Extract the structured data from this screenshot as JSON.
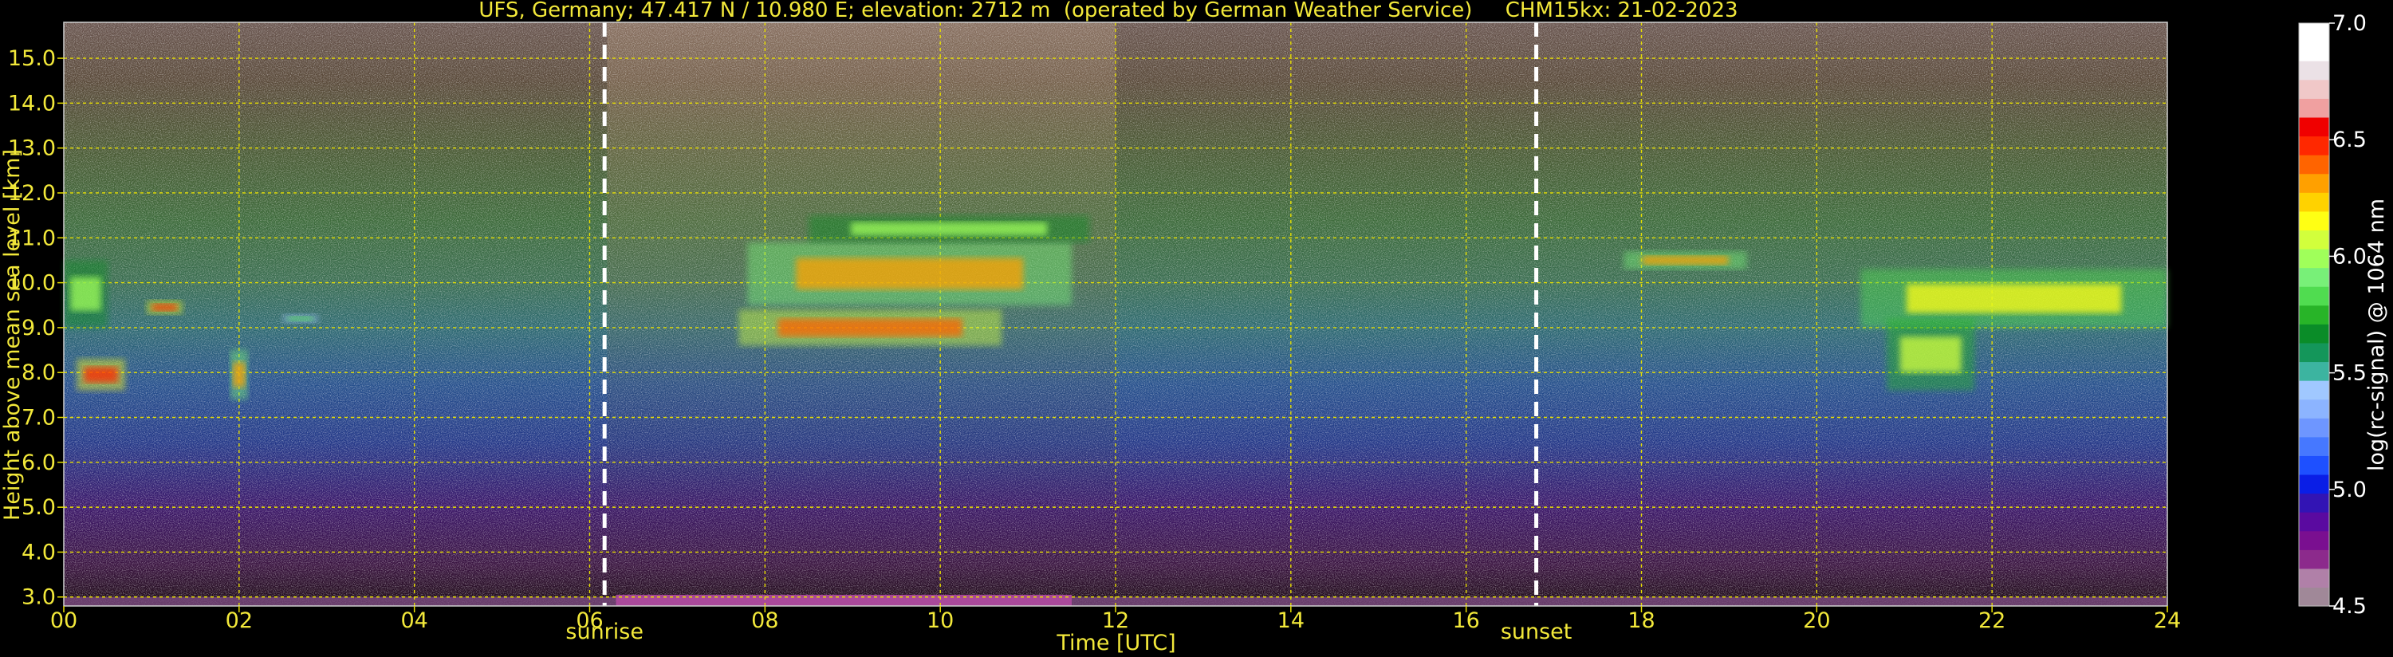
{
  "chart_data": {
    "type": "heatmap",
    "title": "UFS, Germany; 47.417 N / 10.980 E; elevation: 2712 m  (operated by German Weather Service)     CHM15kx: 21-02-2023",
    "xlabel": "Time [UTC]",
    "ylabel": "Height above mean sea level [km]",
    "xlim": [
      0,
      24
    ],
    "ylim": [
      2.8,
      15.8
    ],
    "x_ticks": [
      0,
      2,
      4,
      6,
      8,
      10,
      12,
      14,
      16,
      18,
      20,
      22,
      24
    ],
    "x_tick_labels": [
      "00",
      "02",
      "04",
      "06",
      "08",
      "10",
      "12",
      "14",
      "16",
      "18",
      "20",
      "22",
      "24"
    ],
    "y_ticks": [
      3,
      4,
      5,
      6,
      7,
      8,
      9,
      10,
      11,
      12,
      13,
      14,
      15
    ],
    "y_tick_labels": [
      "3.0",
      "4.0",
      "5.0",
      "6.0",
      "7.0",
      "8.0",
      "9.0",
      "10.0",
      "11.0",
      "12.0",
      "13.0",
      "14.0",
      "15.0"
    ],
    "grid": true,
    "markers": [
      {
        "label": "sunrise",
        "x": 6.17
      },
      {
        "label": "sunset",
        "x": 16.8
      }
    ],
    "colorbar": {
      "label": "log(rc-signal) @ 1064 nm",
      "min": 4.5,
      "max": 7.0,
      "ticks": [
        4.5,
        5.0,
        5.5,
        6.0,
        6.5,
        7.0
      ],
      "tick_labels": [
        "4.5",
        "5.0",
        "5.5",
        "6.0",
        "6.5",
        "7.0"
      ],
      "colors": [
        "#a08898",
        "#b080a8",
        "#8c2a8c",
        "#7a0f90",
        "#5a0aa0",
        "#3214b4",
        "#0a1ee6",
        "#1e50ff",
        "#4678ff",
        "#6e96ff",
        "#8cb4ff",
        "#a0c8ff",
        "#3cb4a0",
        "#14965a",
        "#0a8c28",
        "#28b428",
        "#50dc50",
        "#78f078",
        "#a0ff5a",
        "#d2ff3c",
        "#ffff14",
        "#ffd200",
        "#ffa000",
        "#ff6400",
        "#ff2800",
        "#f00000",
        "#f0a0a0",
        "#f0c8c8",
        "#ebe1e6",
        "#ffffff",
        "#ffffff"
      ]
    },
    "cloud_layers": [
      {
        "x": [
          0.0,
          0.5
        ],
        "y": [
          9.0,
          10.5
        ],
        "value": 6.0
      },
      {
        "x": [
          0.15,
          0.7
        ],
        "y": [
          7.6,
          8.3
        ],
        "value": 6.5
      },
      {
        "x": [
          0.95,
          1.35
        ],
        "y": [
          9.3,
          9.6
        ],
        "value": 6.5
      },
      {
        "x": [
          1.9,
          2.1
        ],
        "y": [
          7.4,
          8.5
        ],
        "value": 6.3
      },
      {
        "x": [
          2.5,
          2.9
        ],
        "y": [
          9.1,
          9.3
        ],
        "value": 5.8
      },
      {
        "x": [
          7.7,
          10.7
        ],
        "y": [
          8.6,
          9.4
        ],
        "value": 6.4
      },
      {
        "x": [
          7.8,
          11.5
        ],
        "y": [
          9.5,
          10.9
        ],
        "value": 6.3
      },
      {
        "x": [
          8.5,
          11.7
        ],
        "y": [
          10.9,
          11.5
        ],
        "value": 6.0
      },
      {
        "x": [
          17.8,
          19.2
        ],
        "y": [
          10.3,
          10.7
        ],
        "value": 6.3
      },
      {
        "x": [
          20.5,
          24.0
        ],
        "y": [
          9.0,
          10.3
        ],
        "value": 6.2
      },
      {
        "x": [
          20.8,
          21.8
        ],
        "y": [
          7.6,
          9.2
        ],
        "value": 6.1
      }
    ]
  }
}
